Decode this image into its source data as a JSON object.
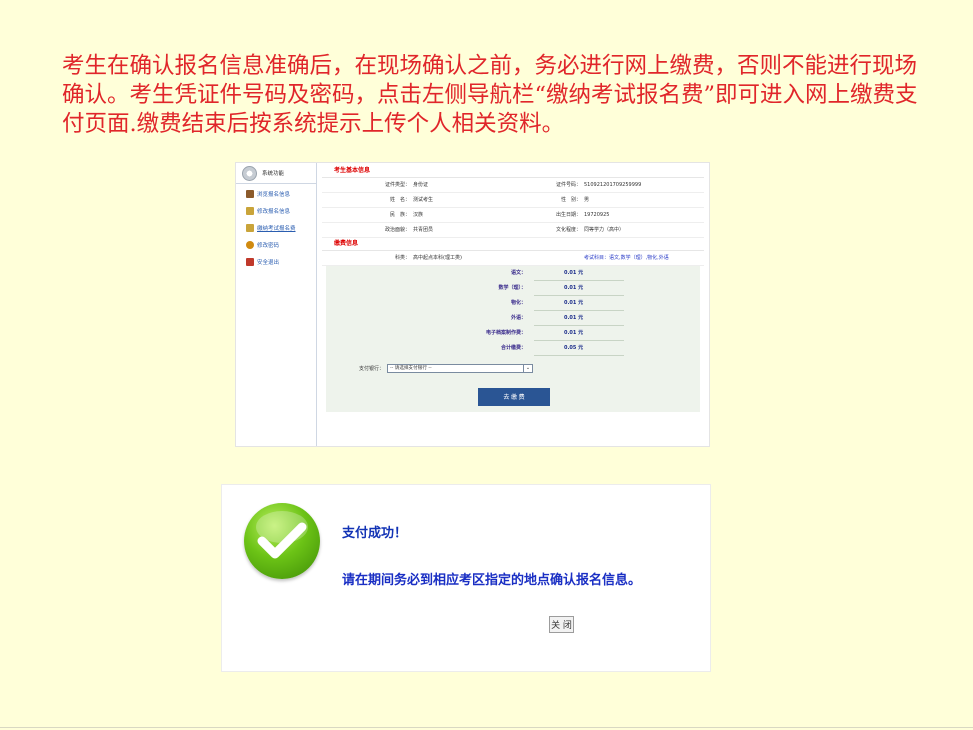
{
  "intro": "考生在确认报名信息准确后，在现场确认之前，务必进行网上缴费，否则不能进行现场确认。考生凭证件号码及密码，点击左侧导航栏“缴纳考试报名费”即可进入网上缴费支付页面.缴费结束后按系统提示上传个人相关资料。",
  "sidebar": {
    "title": "系统功能",
    "items": [
      {
        "label": "浏览报名信息",
        "color": "#8b5a2b"
      },
      {
        "label": "修改报名信息",
        "color": "#c9a43a"
      },
      {
        "label": "缴纳考试报名费",
        "color": "#c9a43a"
      },
      {
        "label": "修改密码",
        "color": "#d08a10"
      },
      {
        "label": "安全退出",
        "color": "#c0392b"
      }
    ]
  },
  "basic": {
    "title": "考生基本信息",
    "rows": [
      {
        "l1": "证件类型：",
        "v1": "身份证",
        "l2": "证件号码：",
        "v2": "510921201709259999"
      },
      {
        "l1": "姓　名：",
        "v1": "测试考生",
        "l2": "性　别：",
        "v2": "男"
      },
      {
        "l1": "民　族：",
        "v1": "汉族",
        "l2": "出生日期：",
        "v2": "19720925"
      },
      {
        "l1": "政治面貌：",
        "v1": "共青团员",
        "l2": "文化程度：",
        "v2": "同等学力（高中）"
      }
    ]
  },
  "fee": {
    "title": "缴费信息",
    "subject_row": {
      "l1": "科类：",
      "v1": "高中起点本科(理工类)",
      "v2": "考试科目：语文,数学（理）,物化,外语"
    },
    "items": [
      {
        "label": "语文：",
        "amount": "0.01 元"
      },
      {
        "label": "数学（理）：",
        "amount": "0.01 元"
      },
      {
        "label": "物化：",
        "amount": "0.01 元"
      },
      {
        "label": "外语：",
        "amount": "0.01 元"
      },
      {
        "label": "电子档案制作费：",
        "amount": "0.01 元"
      },
      {
        "label": "合计缴费：",
        "amount": "0.05 元"
      }
    ],
    "bank_label": "支付银行：",
    "bank_value": "-- 请选择支付银行 --",
    "pay_button": "去 缴 费"
  },
  "dialog": {
    "success": "支付成功！",
    "instruction": "请在期间务必到相应考区指定的地点确认报名信息。",
    "close_button": "关 闭"
  }
}
